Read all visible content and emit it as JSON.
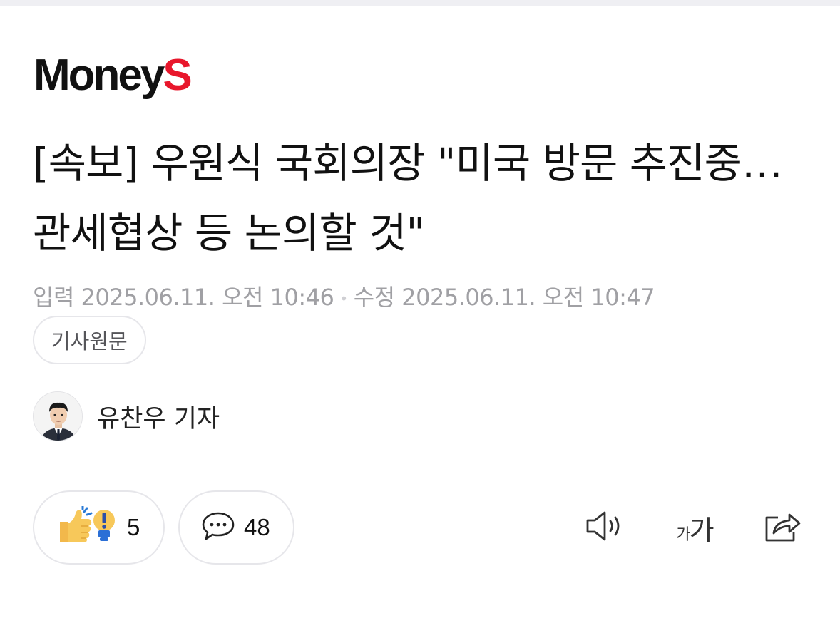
{
  "brand": {
    "name_main": "Money",
    "name_accent": "S",
    "accent_color": "#e8172c"
  },
  "article": {
    "headline": "[속보] 우원식 국회의장 \"미국 방문 추진중… 관세협상 등 논의할 것\"",
    "published": "입력 2025.06.11. 오전 10:46",
    "modified": "수정 2025.06.11. 오전 10:47",
    "separator": "•",
    "original_link_label": "기사원문"
  },
  "author": {
    "name": "유찬우 기자",
    "avatar_icon": "reporter-avatar"
  },
  "engagement": {
    "reaction_icon": "thumbs-up-exclaim-emoji-icon",
    "reaction_count": "5",
    "comment_icon": "speech-bubble-icon",
    "comment_count": "48"
  },
  "tools": {
    "speak_icon": "speaker-icon",
    "font_small": "가",
    "font_big": "가",
    "share_icon": "share-icon"
  }
}
